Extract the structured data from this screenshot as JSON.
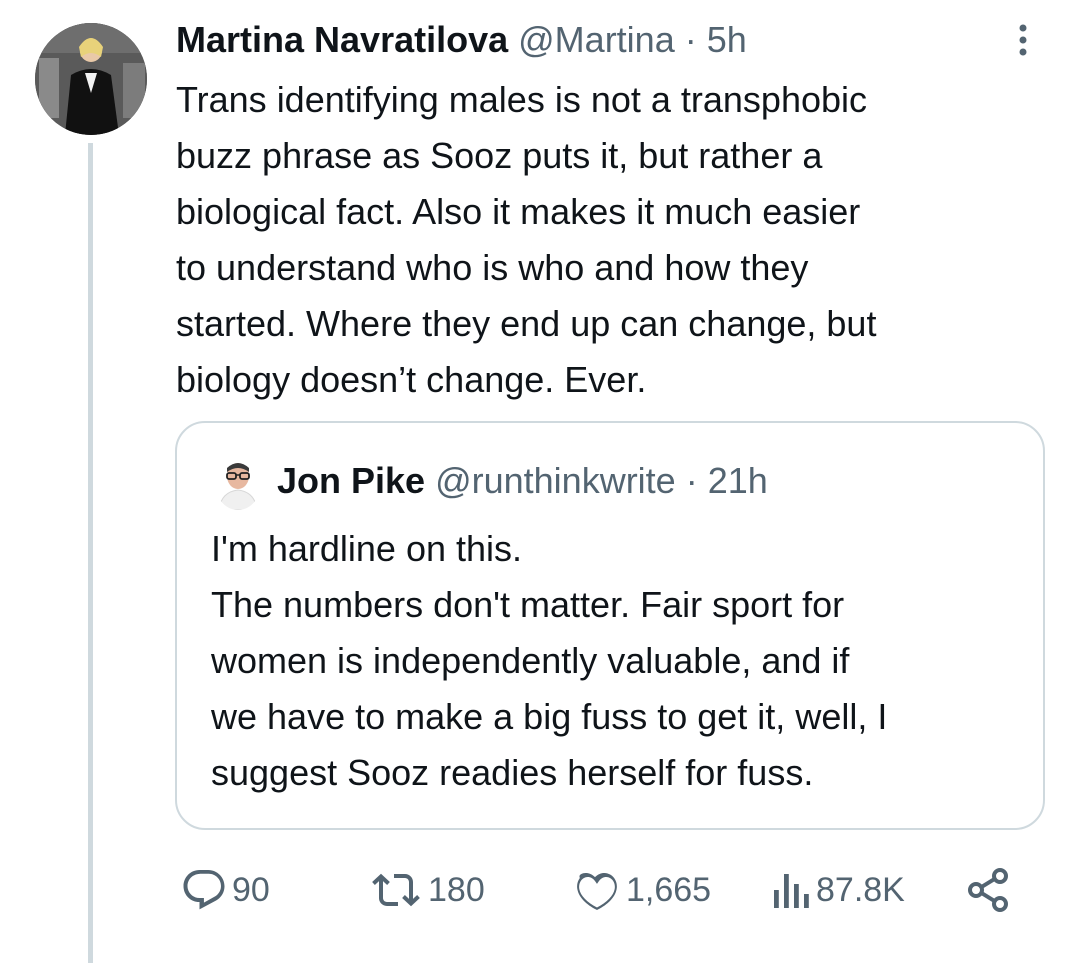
{
  "tweet": {
    "author_name": "Martina Navratilova",
    "author_handle": "@Martina",
    "separator": "·",
    "time": "5h",
    "lines": [
      "Trans identifying males is not a transphobic",
      "buzz phrase as Sooz puts it, but rather a",
      "biological fact. Also it makes it much easier",
      "to understand who is who and how they",
      "started. Where they end up can change, but",
      "biology doesn’t change. Ever."
    ]
  },
  "quote": {
    "author_name": "Jon Pike",
    "author_handle": "@runthinkwrite",
    "separator": "·",
    "time": "21h",
    "lines": [
      "I'm hardline on this.",
      "The numbers don't matter. Fair sport for",
      "women is independently valuable, and if",
      "we have to make a big fuss to get it, well, I",
      "suggest Sooz readies herself for fuss."
    ]
  },
  "actions": {
    "replies": "90",
    "reposts": "180",
    "likes": "1,665",
    "views": "87.8K"
  },
  "icons": {
    "reply": "speech-bubble-icon",
    "repost": "repost-arrows-icon",
    "like": "heart-icon",
    "views": "bar-chart-icon",
    "share": "share-nodes-icon",
    "more": "vertical-dots-icon"
  },
  "colors": {
    "text": "#0f1419",
    "secondary": "#536471",
    "border": "#cfd9de"
  }
}
